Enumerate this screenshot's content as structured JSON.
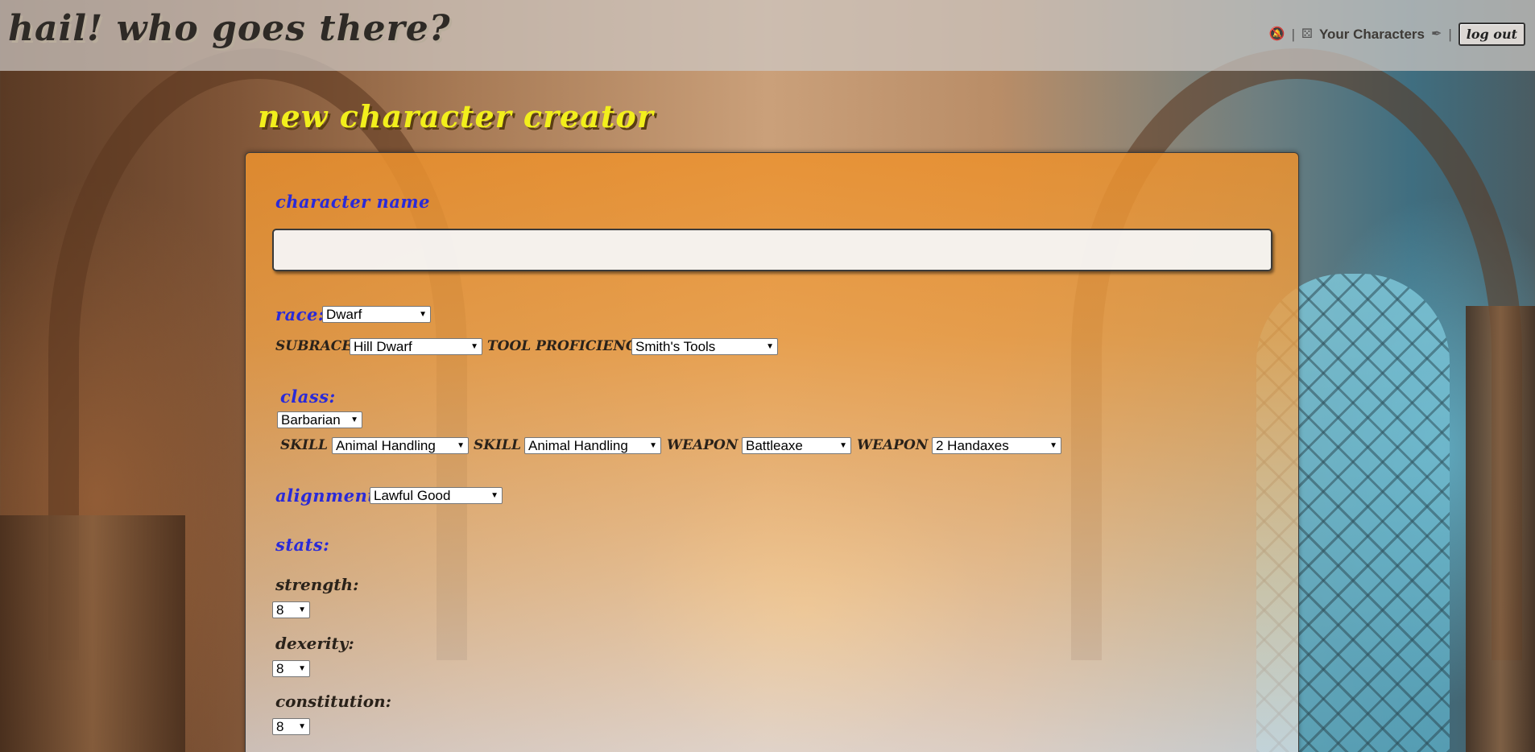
{
  "header": {
    "site_title": "Hail! Who Goes There?",
    "nav": {
      "your_characters": "Your Characters",
      "separator": "|",
      "logout": "Log Out"
    }
  },
  "page": {
    "heading": "New Character Creator"
  },
  "form": {
    "character_name_label": "Character Name",
    "character_name_value": "",
    "race_label": "Race:",
    "race_value": "Dwarf",
    "subrace_label": "Subrace:",
    "subrace_value": "Hill Dwarf",
    "tool_label": "Tool Proficiency:",
    "tool_value": "Smith's Tools",
    "class_label": "Class:",
    "class_value": "Barbarian",
    "skill_label": "Skill",
    "skill1_value": "Animal Handling",
    "skill2_value": "Animal Handling",
    "weapon_label": "Weapon",
    "weapon1_value": "Battleaxe",
    "weapon2_value": "2 Handaxes",
    "alignment_label": "Alignment:",
    "alignment_value": "Lawful Good",
    "stats_label": "Stats:",
    "stats": [
      {
        "label": "Strength:",
        "value": "8"
      },
      {
        "label": "Dexerity:",
        "value": "8"
      },
      {
        "label": "Constitution:",
        "value": "8"
      }
    ]
  },
  "icons": {
    "bell_off": "bell-off-icon",
    "dice": "dice-icon",
    "quill": "quill-icon"
  },
  "colors": {
    "heading": "#f2ef1c",
    "section_label": "#2a2ad8",
    "panel": "#ec912d"
  }
}
